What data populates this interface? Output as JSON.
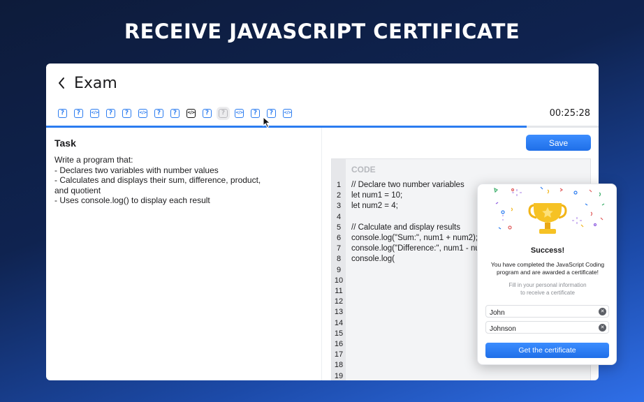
{
  "headline": "RECEIVE JAVASCRIPT CERTIFICATE",
  "window": {
    "title": "Exam",
    "timer": "00:25:28",
    "progress": 0.87,
    "questions": [
      {
        "kind": "question",
        "glyph": "?",
        "state": "normal"
      },
      {
        "kind": "question",
        "glyph": "?",
        "state": "normal"
      },
      {
        "kind": "code",
        "glyph": "</>",
        "state": "normal"
      },
      {
        "kind": "question",
        "glyph": "?",
        "state": "normal"
      },
      {
        "kind": "question",
        "glyph": "?",
        "state": "normal"
      },
      {
        "kind": "code",
        "glyph": "</>",
        "state": "normal"
      },
      {
        "kind": "question",
        "glyph": "?",
        "state": "normal"
      },
      {
        "kind": "question",
        "glyph": "?",
        "state": "normal"
      },
      {
        "kind": "code",
        "glyph": "</>",
        "state": "active"
      },
      {
        "kind": "question",
        "glyph": "?",
        "state": "normal"
      },
      {
        "kind": "question",
        "glyph": "?",
        "state": "hover"
      },
      {
        "kind": "code",
        "glyph": "</>",
        "state": "normal"
      },
      {
        "kind": "question",
        "glyph": "?",
        "state": "normal"
      },
      {
        "kind": "question",
        "glyph": "?",
        "state": "normal"
      },
      {
        "kind": "code",
        "glyph": "</>",
        "state": "normal"
      }
    ]
  },
  "task": {
    "title": "Task",
    "lines": [
      "Write a program that:",
      "- Declares two variables with number values",
      "- Calculates and displays their sum, difference, product,",
      "and quotient",
      "- Uses console.log() to display each result"
    ]
  },
  "editor": {
    "save_label": "Save",
    "code_label": "CODE",
    "line_numbers": [
      "1",
      "2",
      "3",
      "4",
      "5",
      "6",
      "7",
      "8",
      "9",
      "10",
      "11",
      "12",
      "13",
      "14",
      "15",
      "16",
      "17",
      "18",
      "19"
    ],
    "code": [
      "// Declare two number variables",
      "let num1 = 10;",
      "let num2 = 4;",
      "",
      "// Calculate and display results",
      "console.log(\"Sum:\", num1 + num2);",
      "console.log(\"Difference:\", num1 - num2);",
      "console.log("
    ]
  },
  "success": {
    "title": "Success!",
    "message": "You have completed the JavaScript Coding program and are awarded a certificate!",
    "hint_line1": "Fill in your personal information",
    "hint_line2": "to receive a certificate",
    "first_name": "John",
    "last_name": "Johnson",
    "button_label": "Get the certificate"
  },
  "colors": {
    "accent": "#2b7cf0",
    "trophy": "#f2b416"
  }
}
